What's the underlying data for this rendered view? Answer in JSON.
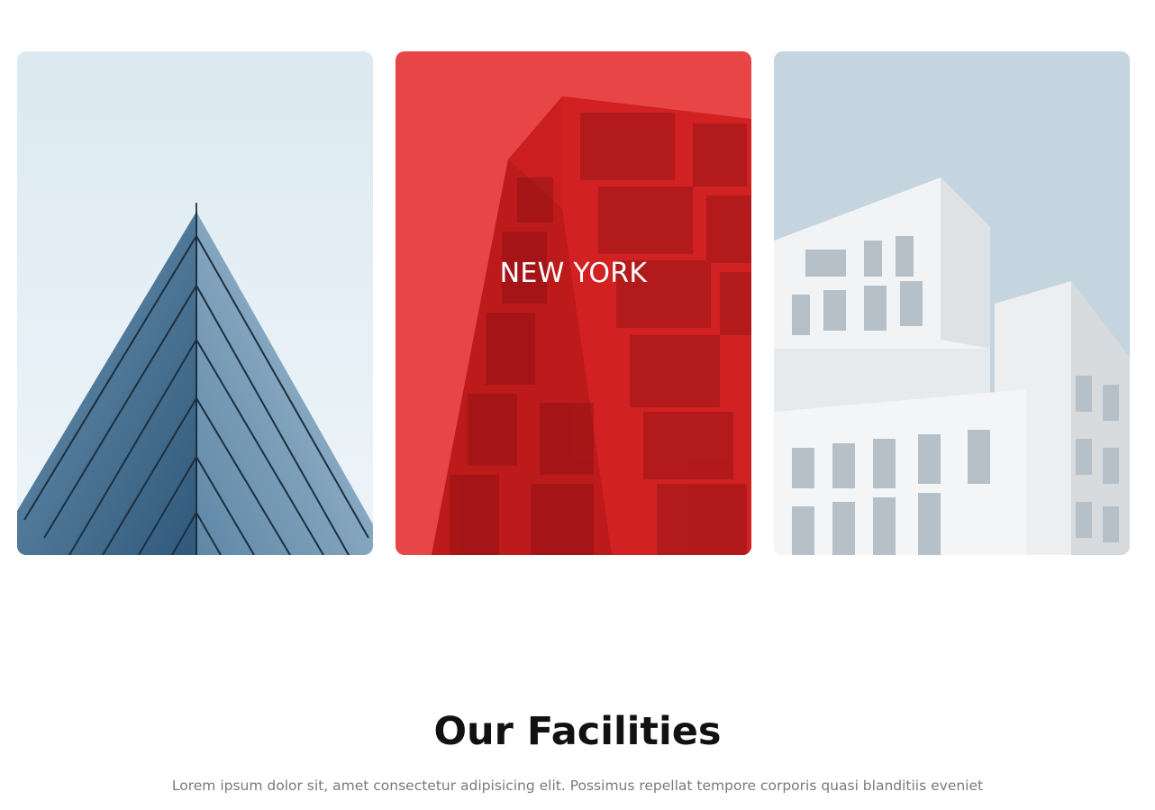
{
  "cards": [
    {
      "image": "glass-pyramid-building-photo",
      "label": ""
    },
    {
      "image": "red-tinted-tower-photo",
      "label": "NEW YORK",
      "overlay_color": "#e8262c"
    },
    {
      "image": "white-modular-building-photo",
      "label": ""
    }
  ],
  "facilities": {
    "title": "Our Facilities",
    "subtitle": "Lorem ipsum dolor sit, amet consectetur adipisicing elit. Possimus repellat tempore corporis quasi blanditiis eveniet"
  }
}
